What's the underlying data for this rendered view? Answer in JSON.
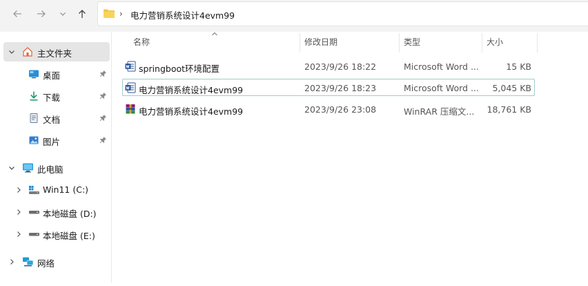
{
  "address_bar": {
    "path": "电力营销系统设计4evm99",
    "separator": "›"
  },
  "colors": {
    "accent": "#0067c0",
    "folder_yellow": "#f4c542",
    "selected_bg": "#e5e5e5",
    "focus_border": "#a0cccb"
  },
  "sidebar": {
    "items": [
      {
        "label": "主文件夹",
        "icon": "home-icon",
        "expanded": true,
        "selected": true
      },
      {
        "label": "桌面",
        "icon": "desktop-icon",
        "pinned": true
      },
      {
        "label": "下载",
        "icon": "download-icon",
        "pinned": true
      },
      {
        "label": "文档",
        "icon": "document-icon",
        "pinned": true
      },
      {
        "label": "图片",
        "icon": "pictures-icon",
        "pinned": true
      },
      {
        "label": "此电脑",
        "icon": "computer-icon",
        "expanded": true
      },
      {
        "label": "Win11 (C:)",
        "icon": "windows-drive-icon"
      },
      {
        "label": "本地磁盘 (D:)",
        "icon": "drive-icon"
      },
      {
        "label": "本地磁盘 (E:)",
        "icon": "drive-icon"
      },
      {
        "label": "网络",
        "icon": "network-icon"
      }
    ]
  },
  "columns": {
    "name": "名称",
    "date": "修改日期",
    "type": "类型",
    "size": "大小"
  },
  "files": [
    {
      "name": "springboot环境配置",
      "date": "2023/9/26 18:22",
      "type": "Microsoft Word ...",
      "size": "15 KB",
      "icon": "word-file-icon"
    },
    {
      "name": "电力营销系统设计4evm99",
      "date": "2023/9/26 18:23",
      "type": "Microsoft Word ...",
      "size": "5,045 KB",
      "icon": "word-file-icon",
      "focused": true
    },
    {
      "name": "电力营销系统设计4evm99",
      "date": "2023/9/26 23:08",
      "type": "WinRAR 压缩文...",
      "size": "18,761 KB",
      "icon": "winrar-archive-icon"
    }
  ]
}
